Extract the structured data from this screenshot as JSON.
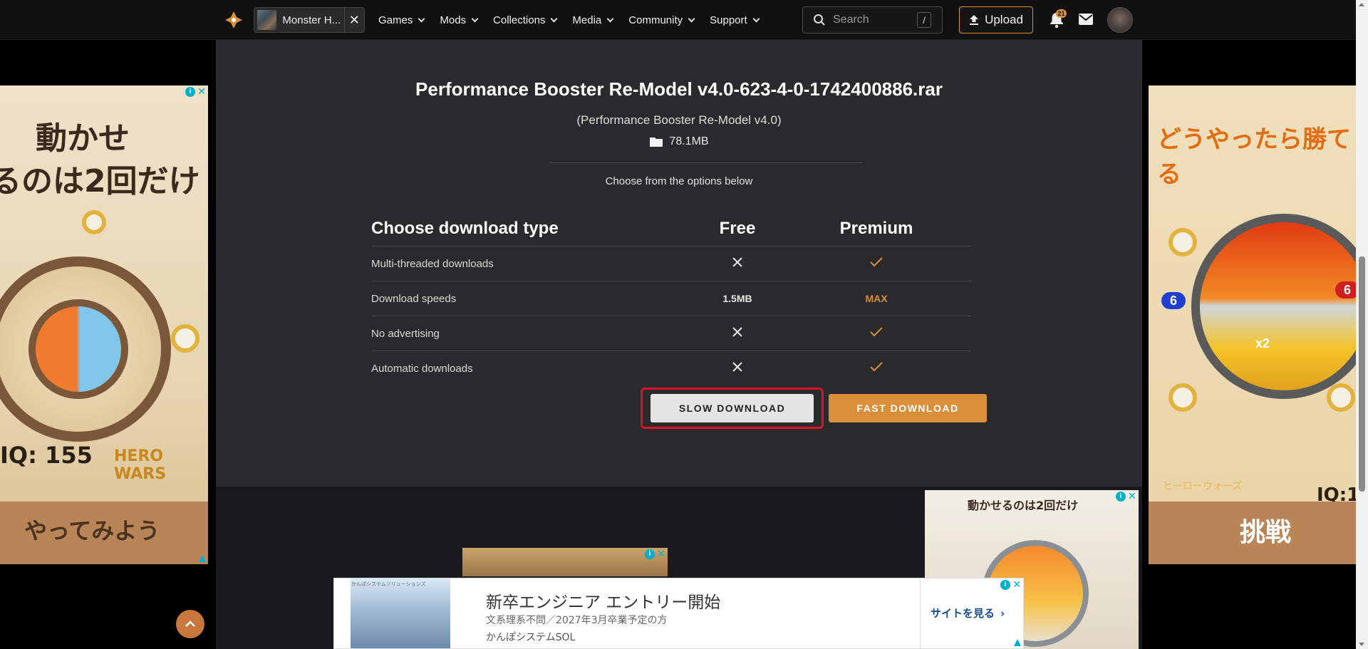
{
  "nav": {
    "game_chip_label": "Monster H...",
    "close_symbol": "✕",
    "links": [
      "Games",
      "Mods",
      "Collections",
      "Media",
      "Community",
      "Support"
    ],
    "search_placeholder": "Search",
    "search_shortcut": "/",
    "upload_label": "Upload",
    "notification_count": "21"
  },
  "file": {
    "title": "Performance Booster Re-Model v4.0-623-4-0-1742400886.rar",
    "subtitle": "(Performance Booster Re-Model v4.0)",
    "size": "78.1MB",
    "choose_text": "Choose from the options below"
  },
  "download_table": {
    "header": {
      "feature": "Choose download type",
      "free": "Free",
      "premium": "Premium"
    },
    "rows": [
      {
        "feature": "Multi-threaded downloads",
        "free": "cross",
        "premium": "check"
      },
      {
        "feature": "Download speeds",
        "free_text": "1.5MB",
        "premium_text": "MAX"
      },
      {
        "feature": "No advertising",
        "free": "cross",
        "premium": "check"
      },
      {
        "feature": "Automatic downloads",
        "free": "cross",
        "premium": "check"
      }
    ]
  },
  "buttons": {
    "slow": "SLOW DOWNLOAD",
    "fast": "FAST DOWNLOAD"
  },
  "ads": {
    "left": {
      "headline_1": "動かせ",
      "headline_2": "るのは2回だけ",
      "iq": "IQ: 155",
      "brand": "HERO WARS",
      "cta": "やってみよう"
    },
    "right": {
      "headline": "どうやったら勝てる",
      "left_count": "6",
      "right_count": "6",
      "multiplier": "x2",
      "iq": "IQ:1",
      "brand": "ヒーローウォーズ",
      "cta": "挑戦"
    },
    "small_right": {
      "headline": "動かせるのは2回だけ"
    },
    "bottom": {
      "tag": "かんぽシステムソリューションズ",
      "headline": "新卒エンジニア エントリー開始",
      "sub": "文系理系不問／2027年3月卒業予定の方",
      "company": "かんぽシステムSOL",
      "cta": "サイトを見る"
    },
    "info_symbol": "i"
  },
  "colors": {
    "accent": "#d98f3a",
    "highlight": "#e0102b",
    "panel": "#2a2a2c"
  }
}
